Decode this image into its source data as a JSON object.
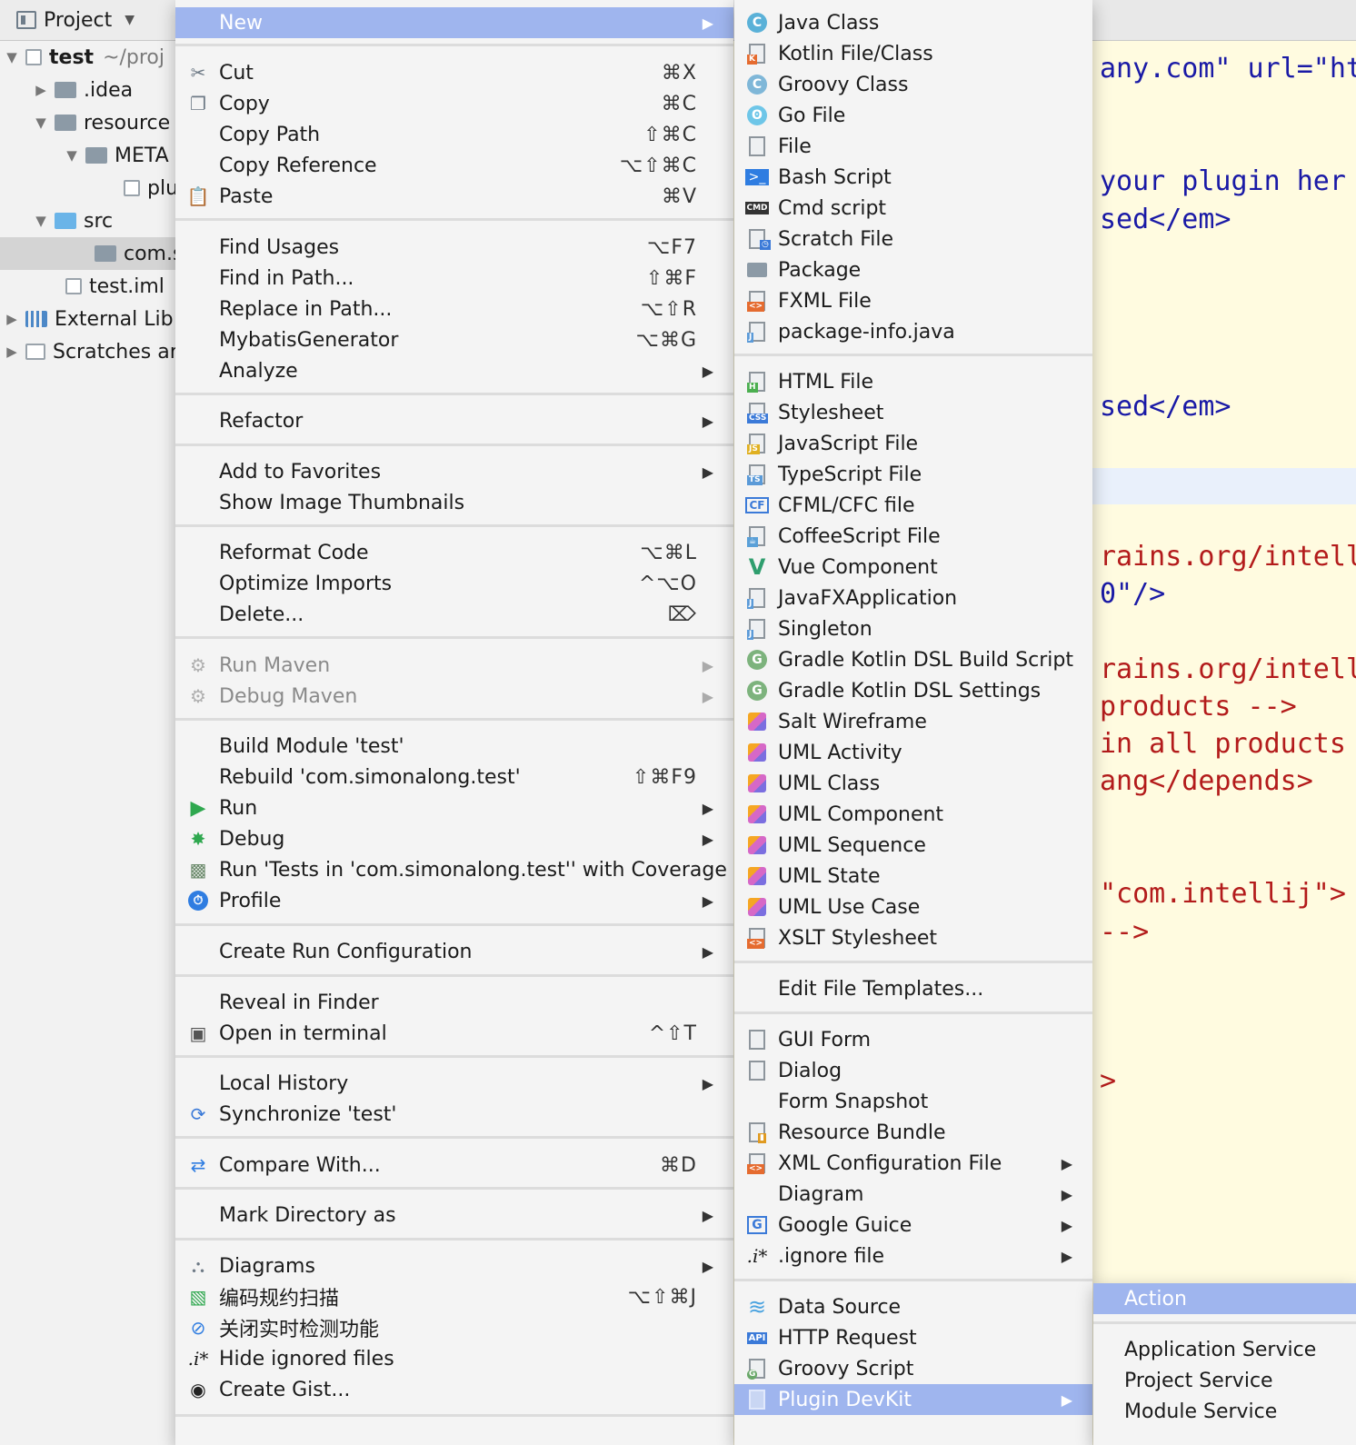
{
  "project_panel": {
    "title": "Project",
    "tree": [
      {
        "label": "test",
        "suffix": "~/proj"
      },
      {
        "label": ".idea"
      },
      {
        "label": "resource"
      },
      {
        "label": "META"
      },
      {
        "label": "plu"
      },
      {
        "label": "src"
      },
      {
        "label": "com.s"
      },
      {
        "label": "test.iml"
      },
      {
        "label": "External Lib"
      },
      {
        "label": "Scratches ar"
      }
    ]
  },
  "editor": {
    "code_lines": [
      "any.com\" url=\"ht",
      "your plugin her",
      "sed</em>",
      "sed</em>",
      "rains.org/intell",
      "0\"/>",
      "rains.org/intell",
      "products -->",
      "in all products",
      "ang</depends>",
      "\"com.intellij\">",
      "-->",
      ">"
    ]
  },
  "main_menu": {
    "new": "New",
    "cut": "Cut",
    "cut_sc": "⌘X",
    "copy": "Copy",
    "copy_sc": "⌘C",
    "copy_path": "Copy Path",
    "copy_path_sc": "⇧⌘C",
    "copy_reference": "Copy Reference",
    "copy_reference_sc": "⌥⇧⌘C",
    "paste": "Paste",
    "paste_sc": "⌘V",
    "find_usages": "Find Usages",
    "find_usages_sc": "⌥F7",
    "find_in_path": "Find in Path...",
    "find_in_path_sc": "⇧⌘F",
    "replace_in_path": "Replace in Path...",
    "replace_in_path_sc": "⌥⇧R",
    "mybatis": "MybatisGenerator",
    "mybatis_sc": "⌥⌘G",
    "analyze": "Analyze",
    "refactor": "Refactor",
    "add_favorites": "Add to Favorites",
    "show_thumbnails": "Show Image Thumbnails",
    "reformat": "Reformat Code",
    "reformat_sc": "⌥⌘L",
    "optimize": "Optimize Imports",
    "optimize_sc": "^⌥O",
    "delete": "Delete...",
    "delete_sc": "⌦",
    "run_maven": "Run Maven",
    "debug_maven": "Debug Maven",
    "build_module": "Build Module 'test'",
    "rebuild": "Rebuild 'com.simonalong.test'",
    "rebuild_sc": "⇧⌘F9",
    "run": "Run",
    "debug": "Debug",
    "run_coverage": "Run 'Tests in 'com.simonalong.test'' with Coverage",
    "profile": "Profile",
    "create_run_config": "Create Run Configuration",
    "reveal_finder": "Reveal in Finder",
    "open_terminal": "Open in terminal",
    "open_terminal_sc": "^⇧T",
    "local_history": "Local History",
    "synchronize": "Synchronize 'test'",
    "compare_with": "Compare With...",
    "compare_with_sc": "⌘D",
    "mark_directory": "Mark Directory as",
    "diagrams": "Diagrams",
    "coding_scan": "编码规约扫描",
    "coding_scan_sc": "⌥⇧⌘J",
    "close_realtime": "关闭实时检测功能",
    "hide_ignored": "Hide ignored files",
    "create_gist": "Create Gist..."
  },
  "new_menu": {
    "items": [
      "Java Class",
      "Kotlin File/Class",
      "Groovy Class",
      "Go File",
      "File",
      "Bash Script",
      "Cmd script",
      "Scratch File",
      "Package",
      "FXML File",
      "package-info.java",
      "HTML File",
      "Stylesheet",
      "JavaScript File",
      "TypeScript File",
      "CFML/CFC file",
      "CoffeeScript File",
      "Vue Component",
      "JavaFXApplication",
      "Singleton",
      "Gradle Kotlin DSL Build Script",
      "Gradle Kotlin DSL Settings",
      "Salt Wireframe",
      "UML Activity",
      "UML Class",
      "UML Component",
      "UML Sequence",
      "UML State",
      "UML Use Case",
      "XSLT Stylesheet",
      "Edit File Templates...",
      "GUI Form",
      "Dialog",
      "Form Snapshot",
      "Resource Bundle",
      "XML Configuration File",
      "Diagram",
      "Google Guice",
      ".ignore file",
      "Data Source",
      "HTTP Request",
      "Groovy Script",
      "Plugin DevKit"
    ]
  },
  "devkit_menu": {
    "action": "Action",
    "application_service": "Application Service",
    "project_service": "Project Service",
    "module_service": "Module Service"
  },
  "colors": {
    "highlight": "#9fb5ee",
    "menu_bg": "#f4f4f4",
    "editor_bg": "#fffbe0"
  }
}
